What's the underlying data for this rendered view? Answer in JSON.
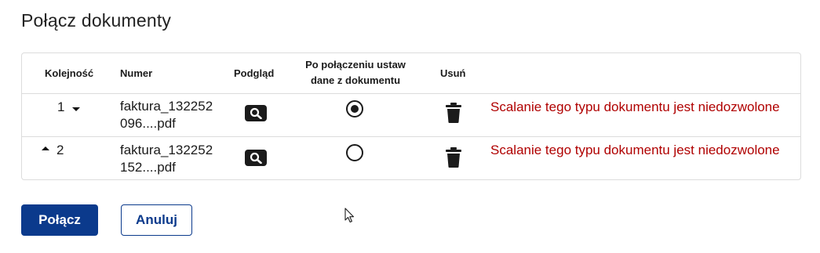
{
  "title": "Połącz dokumenty",
  "table": {
    "headers": {
      "order": "Kolejność",
      "number": "Numer",
      "preview": "Podgląd",
      "set_data_line1": "Po połączeniu ustaw",
      "set_data_line2": "dane z dokumentu",
      "remove": "Usuń"
    },
    "rows": [
      {
        "order": "1",
        "order_controls": [
          "down"
        ],
        "number_line1": "faktura_132252",
        "number_line2": "096....pdf",
        "selected": true,
        "error": "Scalanie tego typu dokumentu jest niedozwolone"
      },
      {
        "order": "2",
        "order_controls": [
          "up"
        ],
        "number_line1": "faktura_132252",
        "number_line2": "152....pdf",
        "selected": false,
        "error": "Scalanie tego typu dokumentu jest niedozwolone"
      }
    ]
  },
  "buttons": {
    "merge": "Połącz",
    "cancel": "Anuluj"
  },
  "icons": {
    "preview": "magnifier-icon",
    "remove": "trash-icon",
    "move_down": "caret-down-icon",
    "move_up": "caret-up-icon",
    "cursor": "mouse-pointer-icon"
  },
  "colors": {
    "primary": "#0b3a8c",
    "error": "#b00000",
    "icon": "#1b1b1b"
  }
}
